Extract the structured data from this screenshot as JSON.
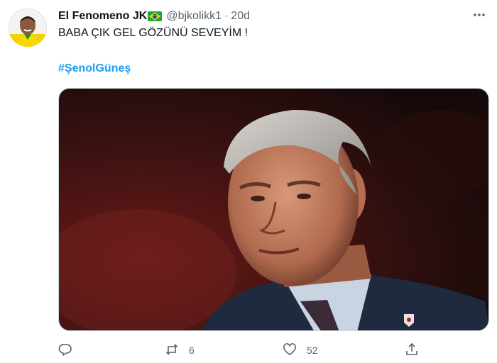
{
  "tweet": {
    "author": {
      "name": "El Fenomeno JK",
      "handle": "@bjkolikk1"
    },
    "separator": "·",
    "time": "20d",
    "text": "BABA ÇIK GEL GÖZÜNÜ SEVEYİM !",
    "hashtag": "#ŞenolGüneş",
    "media": {
      "description_icon": "photo"
    },
    "actions": {
      "reply": {
        "icon": "reply-icon",
        "count": ""
      },
      "retweet": {
        "icon": "retweet-icon",
        "count": "6"
      },
      "like": {
        "icon": "heart-icon",
        "count": "52"
      },
      "share": {
        "icon": "share-icon",
        "count": ""
      }
    }
  },
  "colors": {
    "link": "#1d9bf0",
    "secondary_text": "#536471",
    "primary_text": "#0f1419",
    "media_border": "#cfd9de"
  }
}
